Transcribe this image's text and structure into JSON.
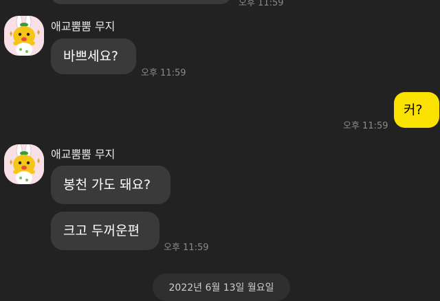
{
  "sender": {
    "name": "애교뿜뿜 무지"
  },
  "messages": {
    "top_time": "오후 11:59",
    "m1": {
      "text": "바쁘세요?",
      "time": "오후 11:59"
    },
    "m2": {
      "text": "커?",
      "time": "오후 11:59"
    },
    "m3": {
      "text": "봉천 가도 돼요?"
    },
    "m4": {
      "text": "크고 두꺼운편",
      "time": "오후 11:59"
    }
  },
  "date_divider": "2022년 6월 13일 월요일",
  "colors": {
    "background": "#222222",
    "bubble_other": "#3a3a3a",
    "bubble_mine": "#fae100",
    "timestamp": "#8a8a8a"
  },
  "icons": {
    "avatar": "muzi-rabbit-avatar"
  }
}
